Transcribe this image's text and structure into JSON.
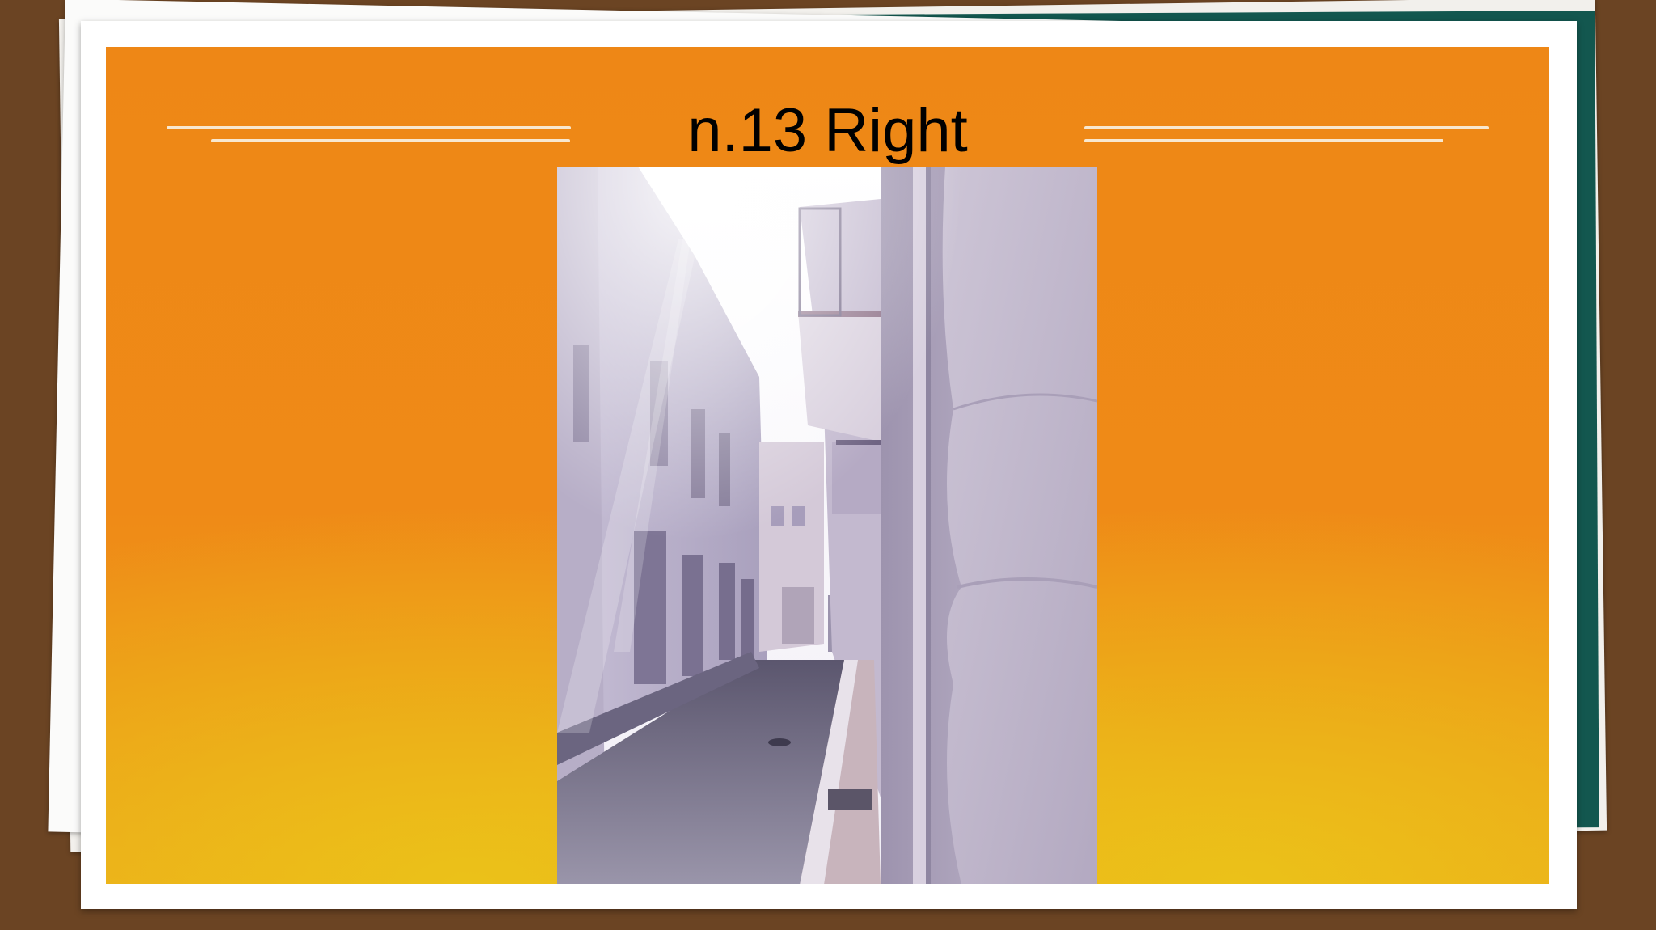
{
  "slide": {
    "title": "n.13 Right"
  },
  "photo": {
    "description_icon": "street-photo"
  },
  "colors": {
    "frame_brown": "#6b4423",
    "teal_layer": "#13574f",
    "slide_orange": "#ef8a17",
    "slide_yellow": "#ebc319",
    "deco_line": "#f8e8cf"
  }
}
